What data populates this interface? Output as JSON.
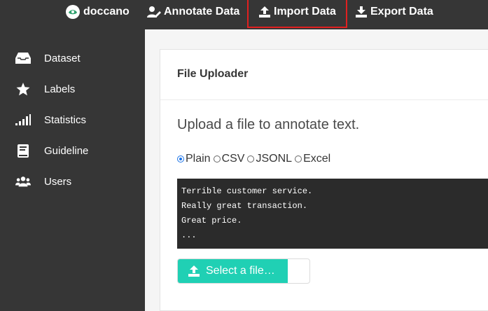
{
  "topbar": {
    "brand": "doccano",
    "annotate_label": "Annotate Data",
    "import_label": "Import Data",
    "export_label": "Export Data"
  },
  "sidebar": {
    "items": [
      {
        "label": "Dataset",
        "icon": "inbox-icon"
      },
      {
        "label": "Labels",
        "icon": "star-icon"
      },
      {
        "label": "Statistics",
        "icon": "signal-icon"
      },
      {
        "label": "Guideline",
        "icon": "book-icon"
      },
      {
        "label": "Users",
        "icon": "users-icon"
      }
    ]
  },
  "main": {
    "card_title": "File Uploader",
    "subtitle": "Upload a file to annotate text.",
    "formats": [
      "Plain",
      "CSV",
      "JSONL",
      "Excel"
    ],
    "selected_format": "Plain",
    "example_lines": [
      "Terrible customer service.",
      "Really great transaction.",
      "Great price.",
      "..."
    ],
    "select_file_label": "Select a file…"
  },
  "colors": {
    "topbar": "#363636",
    "accent": "#20d0b4",
    "highlight_border": "#e02020"
  }
}
